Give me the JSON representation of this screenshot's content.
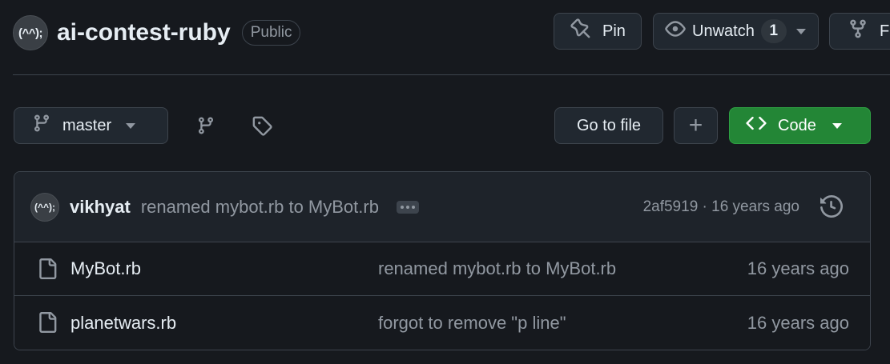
{
  "repo": {
    "owner_avatar_text": "(^^);",
    "name": "ai-contest-ruby",
    "visibility": "Public"
  },
  "actions": {
    "pin_label": "Pin",
    "unwatch_label": "Unwatch",
    "watch_count": "1",
    "fork_label": "Fork"
  },
  "toolbar": {
    "branch": "master",
    "go_to_file": "Go to file",
    "add_label": "+",
    "code_label": "Code"
  },
  "latest_commit": {
    "avatar_text": "(^^);",
    "author": "vikhyat",
    "message": "renamed mybot.rb to MyBot.rb",
    "meta": "2af5919 · 16 years ago"
  },
  "files": [
    {
      "name": "MyBot.rb",
      "commit": "renamed mybot.rb to MyBot.rb",
      "age": "16 years ago",
      "icon": "file-icon"
    },
    {
      "name": "planetwars.rb",
      "commit": "forgot to remove \"p line\"",
      "age": "16 years ago",
      "icon": "file-icon"
    }
  ],
  "colors": {
    "background": "#16191e",
    "code_button": "#238636",
    "border": "#3d444d"
  }
}
